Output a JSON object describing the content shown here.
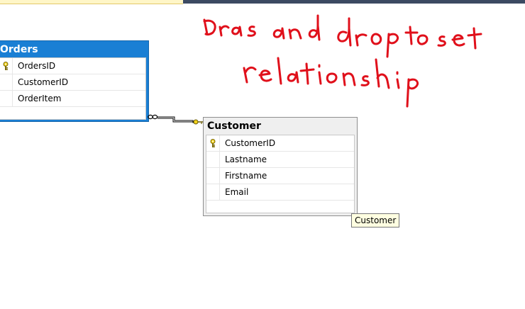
{
  "tables": [
    {
      "id": "orders",
      "title": "Orders",
      "columns": [
        {
          "name": "OrdersID",
          "primary_key": true
        },
        {
          "name": "CustomerID",
          "primary_key": false
        },
        {
          "name": "OrderItem",
          "primary_key": false
        }
      ]
    },
    {
      "id": "customer",
      "title": "Customer",
      "columns": [
        {
          "name": "CustomerID",
          "primary_key": true
        },
        {
          "name": "Lastname",
          "primary_key": false
        },
        {
          "name": "Firstname",
          "primary_key": false
        },
        {
          "name": "Email",
          "primary_key": false
        }
      ]
    }
  ],
  "tooltip": "Customer",
  "annotation": {
    "text": "Drag and drop to set relationship",
    "color": "#e0101b"
  },
  "colors": {
    "orders_header": "#1a7fd4",
    "customer_header": "#efefef",
    "key_icon": "#f2d21a"
  },
  "icons": {
    "primary_key": "key-icon",
    "relationship_many_end": "infinity-icon",
    "relationship_one_end": "key-icon"
  }
}
